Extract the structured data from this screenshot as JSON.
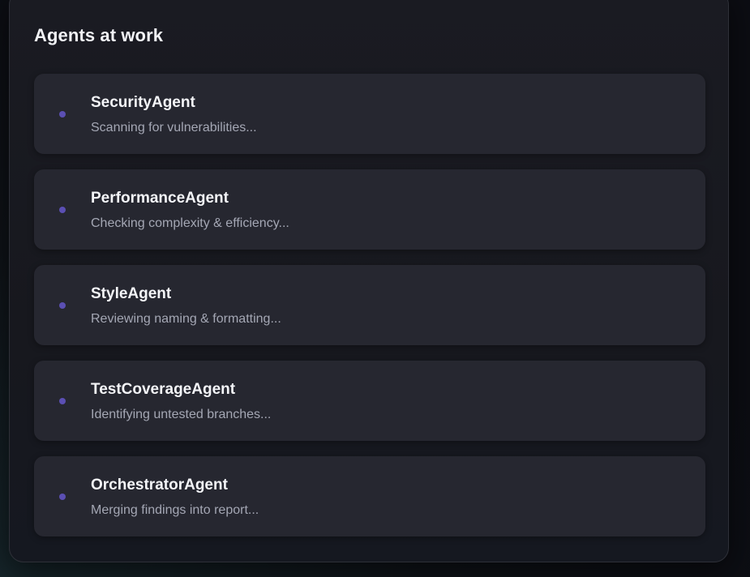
{
  "panel": {
    "title": "Agents at work"
  },
  "colors": {
    "page_background": "#0d0e14",
    "panel_background": "#1a1b22",
    "card_background": "#262730",
    "status_dot": "#5b4fb3",
    "title_text": "#f2f3f7",
    "subtitle_text": "#a4a7b4"
  },
  "icons": {
    "status_indicator": "dot-icon"
  },
  "agents": [
    {
      "name": "SecurityAgent",
      "status": "Scanning for vulnerabilities..."
    },
    {
      "name": "PerformanceAgent",
      "status": "Checking complexity & efficiency..."
    },
    {
      "name": "StyleAgent",
      "status": "Reviewing naming & formatting..."
    },
    {
      "name": "TestCoverageAgent",
      "status": "Identifying untested branches..."
    },
    {
      "name": "OrchestratorAgent",
      "status": "Merging findings into report..."
    }
  ]
}
